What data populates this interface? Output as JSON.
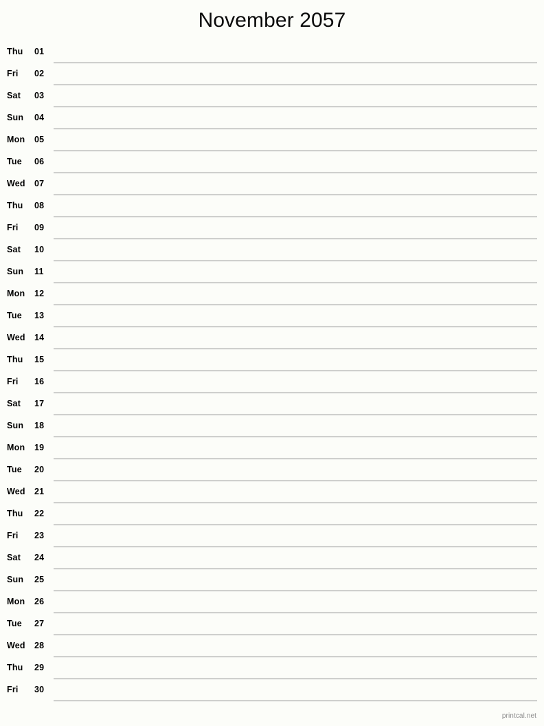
{
  "document": {
    "title": "November 2057",
    "month": "November",
    "year": "2057",
    "type": "printable-notes-calendar",
    "background_color": "#fcfdf9",
    "rule_color": "#8a8a8a",
    "text_color": "#000000",
    "footer_color": "#8c8c8c"
  },
  "footer": {
    "credit": "printcal.net"
  },
  "calendar": {
    "days": [
      {
        "weekday": "Thu",
        "date": "01"
      },
      {
        "weekday": "Fri",
        "date": "02"
      },
      {
        "weekday": "Sat",
        "date": "03"
      },
      {
        "weekday": "Sun",
        "date": "04"
      },
      {
        "weekday": "Mon",
        "date": "05"
      },
      {
        "weekday": "Tue",
        "date": "06"
      },
      {
        "weekday": "Wed",
        "date": "07"
      },
      {
        "weekday": "Thu",
        "date": "08"
      },
      {
        "weekday": "Fri",
        "date": "09"
      },
      {
        "weekday": "Sat",
        "date": "10"
      },
      {
        "weekday": "Sun",
        "date": "11"
      },
      {
        "weekday": "Mon",
        "date": "12"
      },
      {
        "weekday": "Tue",
        "date": "13"
      },
      {
        "weekday": "Wed",
        "date": "14"
      },
      {
        "weekday": "Thu",
        "date": "15"
      },
      {
        "weekday": "Fri",
        "date": "16"
      },
      {
        "weekday": "Sat",
        "date": "17"
      },
      {
        "weekday": "Sun",
        "date": "18"
      },
      {
        "weekday": "Mon",
        "date": "19"
      },
      {
        "weekday": "Tue",
        "date": "20"
      },
      {
        "weekday": "Wed",
        "date": "21"
      },
      {
        "weekday": "Thu",
        "date": "22"
      },
      {
        "weekday": "Fri",
        "date": "23"
      },
      {
        "weekday": "Sat",
        "date": "24"
      },
      {
        "weekday": "Sun",
        "date": "25"
      },
      {
        "weekday": "Mon",
        "date": "26"
      },
      {
        "weekday": "Tue",
        "date": "27"
      },
      {
        "weekday": "Wed",
        "date": "28"
      },
      {
        "weekday": "Thu",
        "date": "29"
      },
      {
        "weekday": "Fri",
        "date": "30"
      }
    ]
  }
}
